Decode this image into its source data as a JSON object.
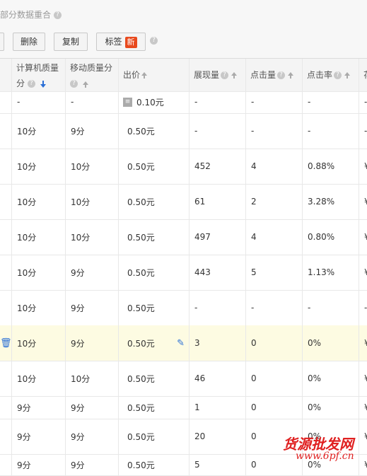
{
  "topbar": {
    "text": "部分数据重合"
  },
  "toolbar": {
    "delete": "删除",
    "copy": "复制",
    "tag": "标签",
    "new_badge": "新"
  },
  "columns": {
    "pc_quality_l1": "计算机质量",
    "pc_quality_l2": "分",
    "mobile_quality": "移动质量分",
    "bid": "出价",
    "impressions": "展现量",
    "clicks": "点击量",
    "ctr": "点击率",
    "partial_next": "花"
  },
  "rows": [
    {
      "pc": "-",
      "mobile": "-",
      "bid": "0.10元",
      "imp": "-",
      "clk": "-",
      "ctr": "-",
      "next": "-"
    },
    {
      "pc": "10分",
      "mobile": "9分",
      "bid": "0.50元",
      "imp": "-",
      "clk": "-",
      "ctr": "-",
      "next": "-"
    },
    {
      "pc": "10分",
      "mobile": "10分",
      "bid": "0.50元",
      "imp": "452",
      "clk": "4",
      "ctr": "0.88%",
      "next": "¥"
    },
    {
      "pc": "10分",
      "mobile": "10分",
      "bid": "0.50元",
      "imp": "61",
      "clk": "2",
      "ctr": "3.28%",
      "next": "¥"
    },
    {
      "pc": "10分",
      "mobile": "10分",
      "bid": "0.50元",
      "imp": "497",
      "clk": "4",
      "ctr": "0.80%",
      "next": "¥"
    },
    {
      "pc": "10分",
      "mobile": "9分",
      "bid": "0.50元",
      "imp": "443",
      "clk": "5",
      "ctr": "1.13%",
      "next": "¥"
    },
    {
      "pc": "10分",
      "mobile": "9分",
      "bid": "0.50元",
      "imp": "-",
      "clk": "-",
      "ctr": "-",
      "next": "-"
    },
    {
      "pc": "10分",
      "mobile": "9分",
      "bid": "0.50元",
      "imp": "3",
      "clk": "0",
      "ctr": "0%",
      "next": "¥"
    },
    {
      "pc": "10分",
      "mobile": "10分",
      "bid": "0.50元",
      "imp": "46",
      "clk": "0",
      "ctr": "0%",
      "next": "¥"
    },
    {
      "pc": "9分",
      "mobile": "9分",
      "bid": "0.50元",
      "imp": "1",
      "clk": "0",
      "ctr": "0%",
      "next": "¥"
    },
    {
      "pc": "9分",
      "mobile": "9分",
      "bid": "0.50元",
      "imp": "20",
      "clk": "0",
      "ctr": "0%",
      "next": "¥"
    },
    {
      "pc": "9分",
      "mobile": "9分",
      "bid": "0.50元",
      "imp": "5",
      "clk": "0",
      "ctr": "0%",
      "next": "¥"
    }
  ],
  "watermark": {
    "line1": "货源批发网",
    "line2": "www.6pf.cn"
  },
  "colors": {
    "highlight_row": "#fdfbe2",
    "new_badge": "#e8491d",
    "sort_active": "#2a6fd6",
    "watermark": "#e02020"
  }
}
